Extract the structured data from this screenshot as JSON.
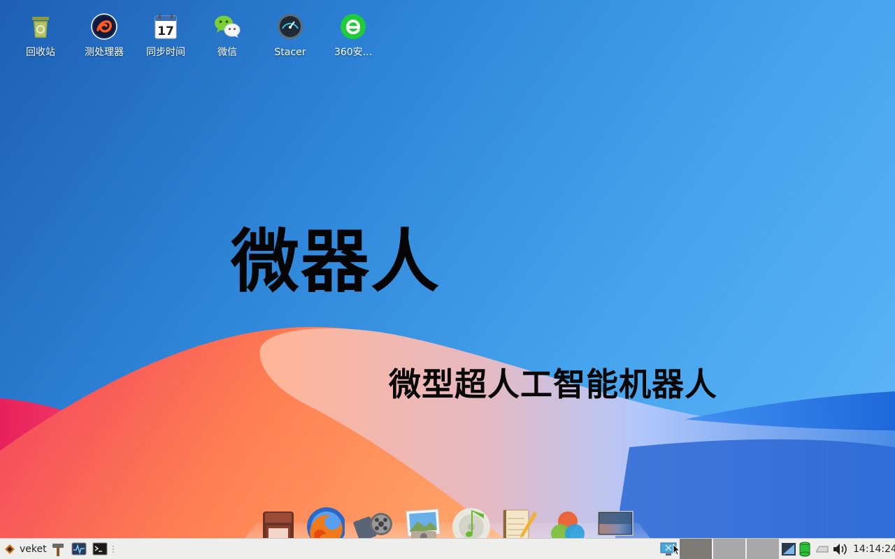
{
  "desktop_icons": [
    {
      "label": "回收站",
      "icon": "trash-icon"
    },
    {
      "label": "测处理器",
      "icon": "cpu-test-icon"
    },
    {
      "label": "同步时间",
      "icon": "calendar-icon",
      "day": "17"
    },
    {
      "label": "微信",
      "icon": "wechat-icon"
    },
    {
      "label": "Stacer",
      "icon": "stacer-icon"
    },
    {
      "label": "360安...",
      "icon": "browser-360-icon"
    }
  ],
  "wallpaper": {
    "title": "微器人",
    "subtitle": "微型超人工智能机器人"
  },
  "dock": {
    "items": [
      "file-manager-icon",
      "firefox-icon",
      "video-player-icon",
      "image-viewer-icon",
      "music-player-icon",
      "notepad-icon",
      "color-picker-icon",
      "desktop-show-icon"
    ]
  },
  "taskbar": {
    "start_label": "veket",
    "clock": "14:14:24",
    "colors": {
      "bg": "#eeeeec",
      "slot_dark": "#7d7a76",
      "slot_light": "#a9a9a9"
    }
  }
}
